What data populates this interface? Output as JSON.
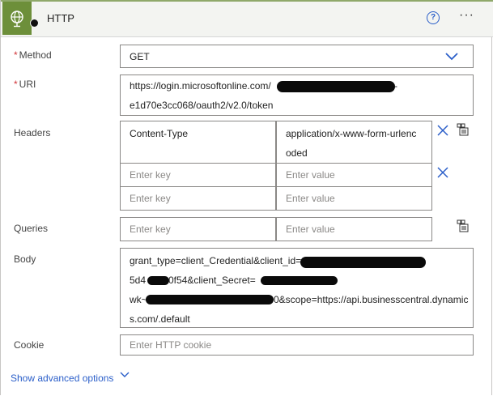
{
  "header": {
    "title": "HTTP",
    "help_icon": "question-circle-icon",
    "more_icon": "ellipsis-icon",
    "action_icon": "globe-icon"
  },
  "method": {
    "label": "Method",
    "required_mark": "*",
    "value": "GET"
  },
  "uri": {
    "label": "URI",
    "required_mark": "*",
    "line1": "https://login.microsoftonline.com/",
    "line1_tail": "-",
    "line2": "e1d70e3cc068/oauth2/v2.0/token"
  },
  "headers": {
    "label": "Headers",
    "rows": [
      {
        "key": "Content-Type",
        "value_line1": "application/x-www-form-urlenc",
        "value_line2": "oded"
      }
    ],
    "key_placeholder": "Enter key",
    "value_placeholder": "Enter value"
  },
  "queries": {
    "label": "Queries",
    "key_placeholder": "Enter key",
    "value_placeholder": "Enter value"
  },
  "body": {
    "label": "Body",
    "line1": "grant_type=client_Credential&client_id=",
    "line2_a": "5d4",
    "line2_b": "0f54&client_Secret=",
    "line3_a": "wk~",
    "line3_b": "0&scope=https://api.businesscentral.dynamic",
    "line4": "s.com/.default"
  },
  "cookie": {
    "label": "Cookie",
    "placeholder": "Enter HTTP cookie"
  },
  "advanced": {
    "label": "Show advanced options"
  },
  "colors": {
    "accent": "#2a5ec9",
    "action": "#6d8f3a",
    "required": "#d13438"
  }
}
